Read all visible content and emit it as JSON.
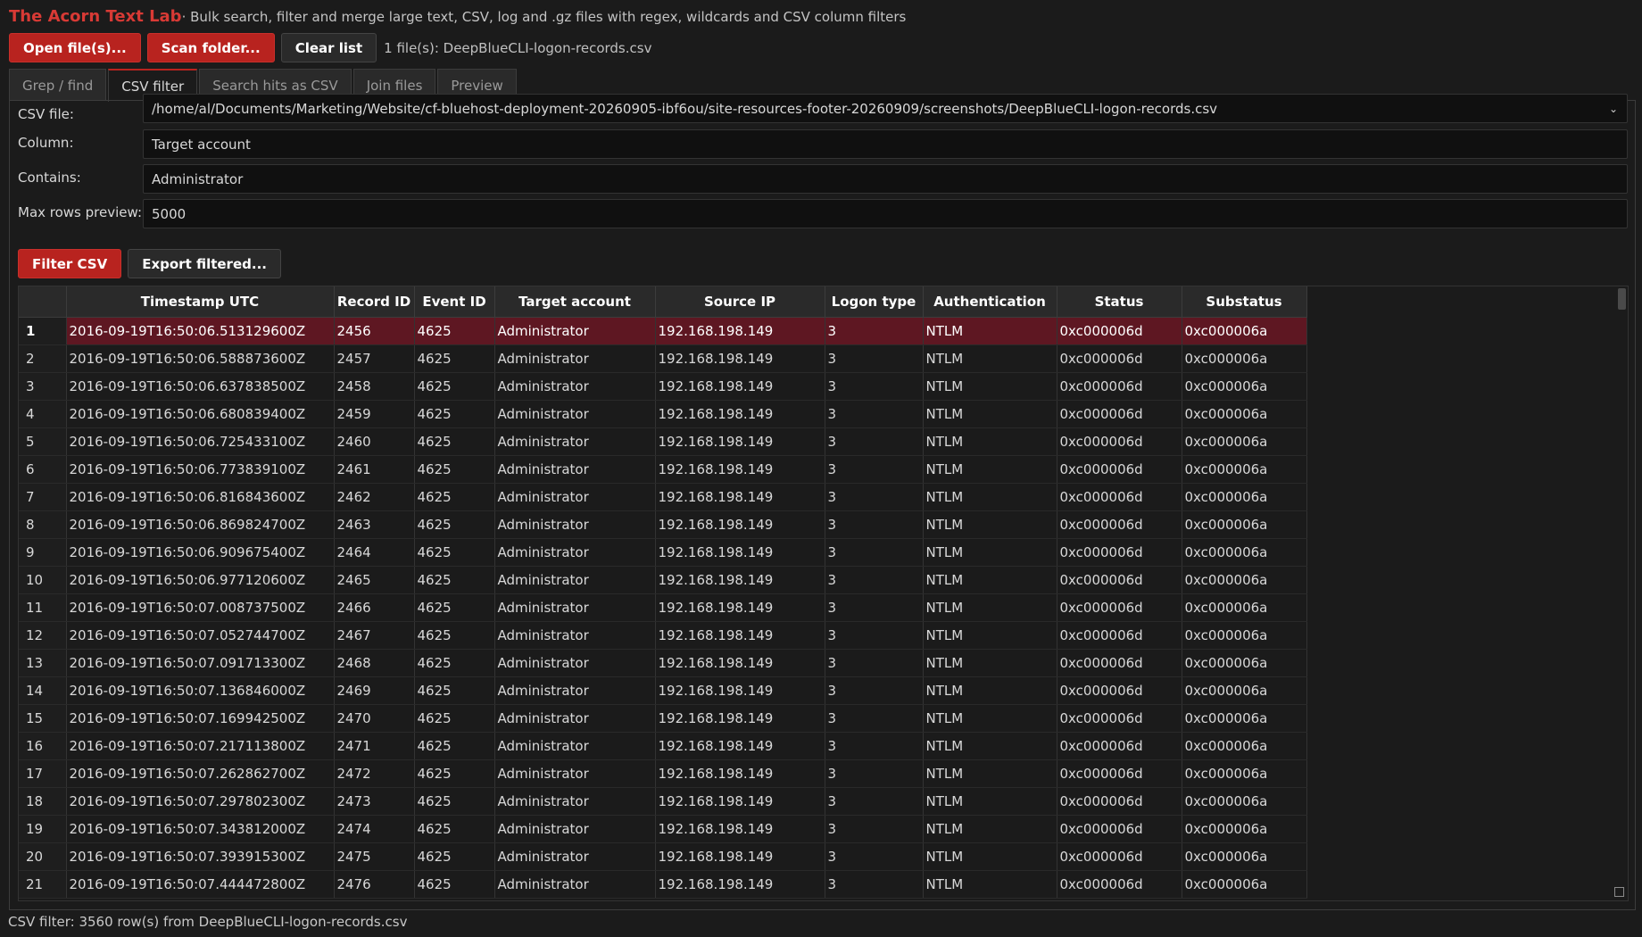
{
  "header": {
    "app_title": "The Acorn Text Lab",
    "subtitle": " · Bulk search, filter and merge large text, CSV, log and .gz files with regex, wildcards and CSV column filters"
  },
  "toolbar": {
    "open_files_label": "Open file(s)...",
    "scan_folder_label": "Scan folder...",
    "clear_list_label": "Clear list",
    "file_count_text": "1 file(s): DeepBlueCLI-logon-records.csv"
  },
  "tabs": [
    {
      "label": "Grep / find",
      "active": false
    },
    {
      "label": "CSV filter",
      "active": true
    },
    {
      "label": "Search hits as CSV",
      "active": false
    },
    {
      "label": "Join files",
      "active": false
    },
    {
      "label": "Preview",
      "active": false
    }
  ],
  "form": {
    "csv_file_label": "CSV file:",
    "csv_file_value": "/home/al/Documents/Marketing/Website/cf-bluehost-deployment-20260905-ibf6ou/site-resources-footer-20260909/screenshots/DeepBlueCLI-logon-records.csv",
    "column_label": "Column:",
    "column_value": "Target account",
    "contains_label": "Contains:",
    "contains_value": "Administrator",
    "max_rows_label": "Max rows preview:",
    "max_rows_value": "5000"
  },
  "actions": {
    "filter_label": "Filter CSV",
    "export_label": "Export filtered..."
  },
  "table": {
    "columns": [
      "",
      "Timestamp UTC",
      "Record ID",
      "Event ID",
      "Target account",
      "Source IP",
      "Logon type",
      "Authentication",
      "Status",
      "Substatus"
    ],
    "selected_row": 1,
    "rows": [
      [
        "1",
        "2016-09-19T16:50:06.513129600Z",
        "2456",
        "4625",
        "Administrator",
        "192.168.198.149",
        "3",
        "NTLM",
        "0xc000006d",
        "0xc000006a"
      ],
      [
        "2",
        "2016-09-19T16:50:06.588873600Z",
        "2457",
        "4625",
        "Administrator",
        "192.168.198.149",
        "3",
        "NTLM",
        "0xc000006d",
        "0xc000006a"
      ],
      [
        "3",
        "2016-09-19T16:50:06.637838500Z",
        "2458",
        "4625",
        "Administrator",
        "192.168.198.149",
        "3",
        "NTLM",
        "0xc000006d",
        "0xc000006a"
      ],
      [
        "4",
        "2016-09-19T16:50:06.680839400Z",
        "2459",
        "4625",
        "Administrator",
        "192.168.198.149",
        "3",
        "NTLM",
        "0xc000006d",
        "0xc000006a"
      ],
      [
        "5",
        "2016-09-19T16:50:06.725433100Z",
        "2460",
        "4625",
        "Administrator",
        "192.168.198.149",
        "3",
        "NTLM",
        "0xc000006d",
        "0xc000006a"
      ],
      [
        "6",
        "2016-09-19T16:50:06.773839100Z",
        "2461",
        "4625",
        "Administrator",
        "192.168.198.149",
        "3",
        "NTLM",
        "0xc000006d",
        "0xc000006a"
      ],
      [
        "7",
        "2016-09-19T16:50:06.816843600Z",
        "2462",
        "4625",
        "Administrator",
        "192.168.198.149",
        "3",
        "NTLM",
        "0xc000006d",
        "0xc000006a"
      ],
      [
        "8",
        "2016-09-19T16:50:06.869824700Z",
        "2463",
        "4625",
        "Administrator",
        "192.168.198.149",
        "3",
        "NTLM",
        "0xc000006d",
        "0xc000006a"
      ],
      [
        "9",
        "2016-09-19T16:50:06.909675400Z",
        "2464",
        "4625",
        "Administrator",
        "192.168.198.149",
        "3",
        "NTLM",
        "0xc000006d",
        "0xc000006a"
      ],
      [
        "10",
        "2016-09-19T16:50:06.977120600Z",
        "2465",
        "4625",
        "Administrator",
        "192.168.198.149",
        "3",
        "NTLM",
        "0xc000006d",
        "0xc000006a"
      ],
      [
        "11",
        "2016-09-19T16:50:07.008737500Z",
        "2466",
        "4625",
        "Administrator",
        "192.168.198.149",
        "3",
        "NTLM",
        "0xc000006d",
        "0xc000006a"
      ],
      [
        "12",
        "2016-09-19T16:50:07.052744700Z",
        "2467",
        "4625",
        "Administrator",
        "192.168.198.149",
        "3",
        "NTLM",
        "0xc000006d",
        "0xc000006a"
      ],
      [
        "13",
        "2016-09-19T16:50:07.091713300Z",
        "2468",
        "4625",
        "Administrator",
        "192.168.198.149",
        "3",
        "NTLM",
        "0xc000006d",
        "0xc000006a"
      ],
      [
        "14",
        "2016-09-19T16:50:07.136846000Z",
        "2469",
        "4625",
        "Administrator",
        "192.168.198.149",
        "3",
        "NTLM",
        "0xc000006d",
        "0xc000006a"
      ],
      [
        "15",
        "2016-09-19T16:50:07.169942500Z",
        "2470",
        "4625",
        "Administrator",
        "192.168.198.149",
        "3",
        "NTLM",
        "0xc000006d",
        "0xc000006a"
      ],
      [
        "16",
        "2016-09-19T16:50:07.217113800Z",
        "2471",
        "4625",
        "Administrator",
        "192.168.198.149",
        "3",
        "NTLM",
        "0xc000006d",
        "0xc000006a"
      ],
      [
        "17",
        "2016-09-19T16:50:07.262862700Z",
        "2472",
        "4625",
        "Administrator",
        "192.168.198.149",
        "3",
        "NTLM",
        "0xc000006d",
        "0xc000006a"
      ],
      [
        "18",
        "2016-09-19T16:50:07.297802300Z",
        "2473",
        "4625",
        "Administrator",
        "192.168.198.149",
        "3",
        "NTLM",
        "0xc000006d",
        "0xc000006a"
      ],
      [
        "19",
        "2016-09-19T16:50:07.343812000Z",
        "2474",
        "4625",
        "Administrator",
        "192.168.198.149",
        "3",
        "NTLM",
        "0xc000006d",
        "0xc000006a"
      ],
      [
        "20",
        "2016-09-19T16:50:07.393915300Z",
        "2475",
        "4625",
        "Administrator",
        "192.168.198.149",
        "3",
        "NTLM",
        "0xc000006d",
        "0xc000006a"
      ],
      [
        "21",
        "2016-09-19T16:50:07.444472800Z",
        "2476",
        "4625",
        "Administrator",
        "192.168.198.149",
        "3",
        "NTLM",
        "0xc000006d",
        "0xc000006a"
      ]
    ]
  },
  "status_bar": {
    "text": "CSV filter: 3560 row(s) from DeepBlueCLI-logon-records.csv"
  },
  "colors": {
    "accent": "#b8231f",
    "title": "#d83a35",
    "selected_row": "#5e1722",
    "background": "#1b1b1b"
  },
  "icons": {
    "combo_arrow": "chevron-down-icon",
    "resize_grip": "resize-grip-icon"
  }
}
